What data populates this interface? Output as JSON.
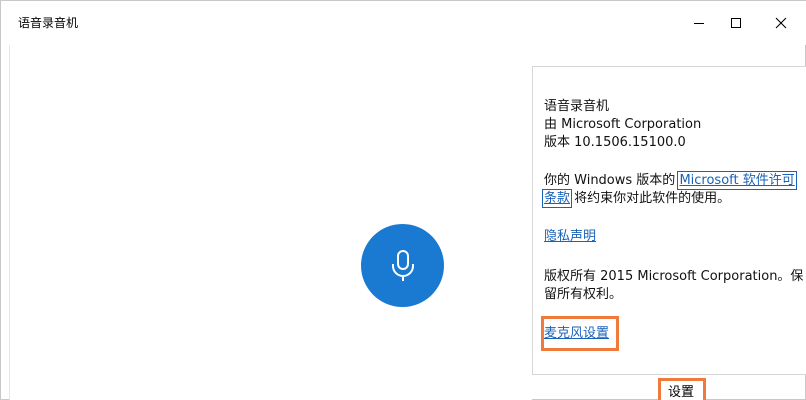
{
  "window": {
    "title": "语音录音机",
    "controls": {
      "minimize_icon": "minimize-icon",
      "maximize_icon": "maximize-icon",
      "close_icon": "close-icon"
    }
  },
  "main": {
    "record_button_icon": "microphone-icon",
    "accent_color": "#1a79d1"
  },
  "about": {
    "app_name": "语音录音机",
    "publisher": "由 Microsoft Corporation",
    "version": "版本 10.1506.15100.0",
    "license_prefix": "你的 Windows 版本的",
    "license_link_part1": "Microsoft 软件许可",
    "license_link_part2": "条款",
    "license_suffix": " 将约束你对此软件的使用。",
    "privacy_link": "隐私声明",
    "copyright_line1": "版权所有 2015 Microsoft Corporation。保",
    "copyright_line2": "留所有权利。",
    "mic_settings_link": "麦克风设置",
    "link_color": "#1a62b7"
  },
  "bottom_bar": {
    "settings_label": "设置"
  },
  "highlight_color": "#f07a3b"
}
